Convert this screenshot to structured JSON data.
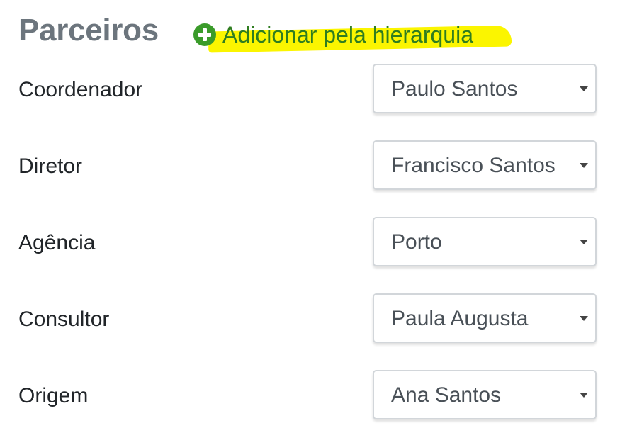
{
  "section": {
    "title": "Parceiros",
    "add_link": {
      "label": "Adicionar pela hierarquia",
      "icon": "plus-circle-icon",
      "highlight_color": "#fbf500",
      "icon_color": "#3a9b2a",
      "text_color": "#2f7d20"
    }
  },
  "fields": [
    {
      "label": "Coordenador",
      "value": "Paulo Santos",
      "icon": "caret-down-icon"
    },
    {
      "label": "Diretor",
      "value": "Francisco Santos",
      "icon": "caret-down-icon"
    },
    {
      "label": "Agência",
      "value": "Porto",
      "icon": "caret-down-icon"
    },
    {
      "label": "Consultor",
      "value": "Paula Augusta",
      "icon": "caret-down-icon"
    },
    {
      "label": "Origem",
      "value": "Ana Santos",
      "icon": "caret-down-icon"
    }
  ]
}
